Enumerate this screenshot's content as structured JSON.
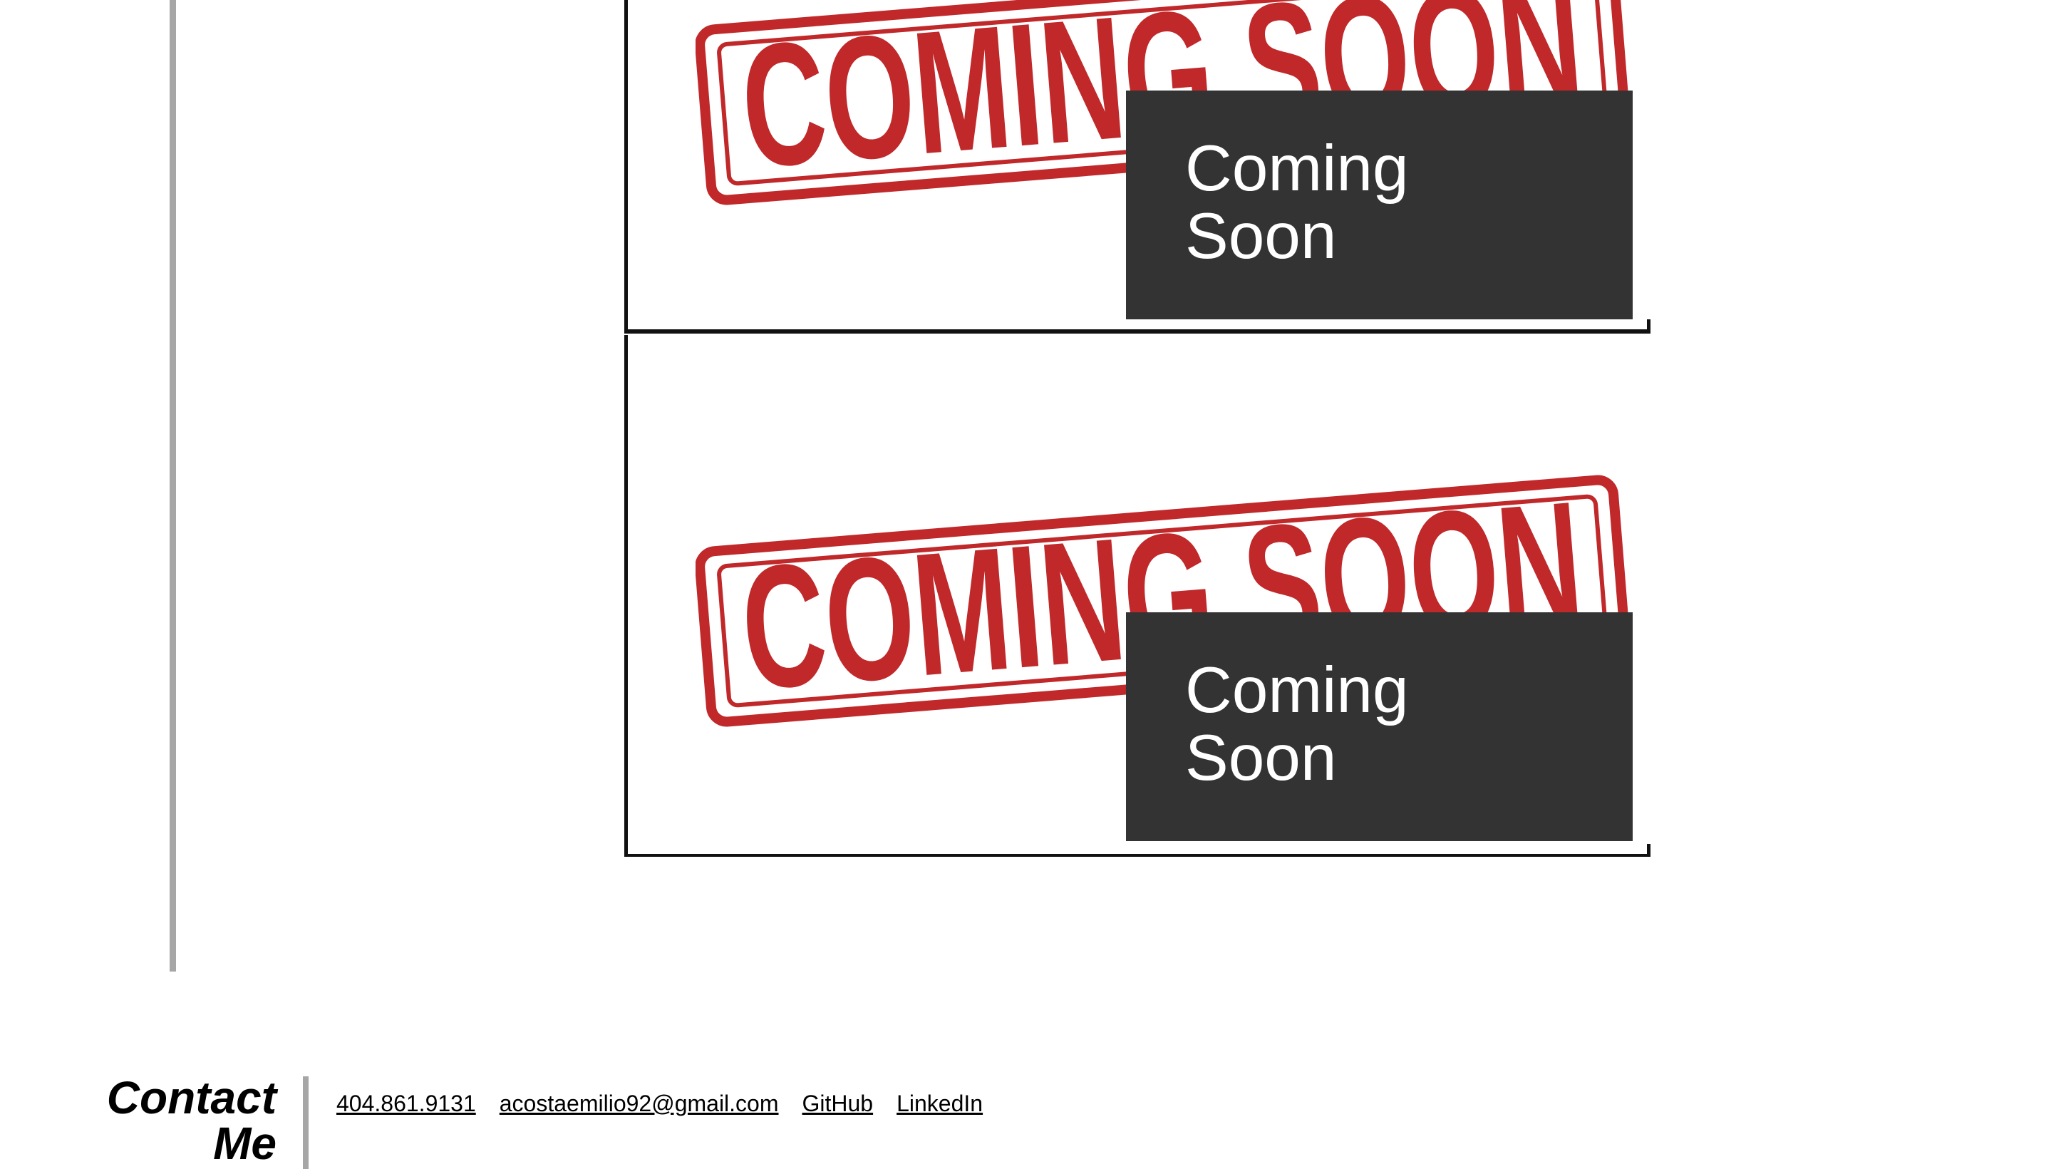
{
  "projects": [
    {
      "stamp_text": "COMING SOON",
      "overlay_text": "Coming Soon",
      "stamp_color": "#c0282a"
    },
    {
      "stamp_text": "COMING SOON",
      "overlay_text": "Coming Soon",
      "stamp_color": "#c0282a"
    }
  ],
  "colors": {
    "overlay_bg": "#333333",
    "rule": "#a6a6a6",
    "stamp_red": "#c0282a"
  },
  "footer": {
    "title": "Contact Me",
    "phone": "404.861.9131",
    "email": "acostaemilio92@gmail.com",
    "github": "GitHub",
    "linkedin": "LinkedIn"
  }
}
